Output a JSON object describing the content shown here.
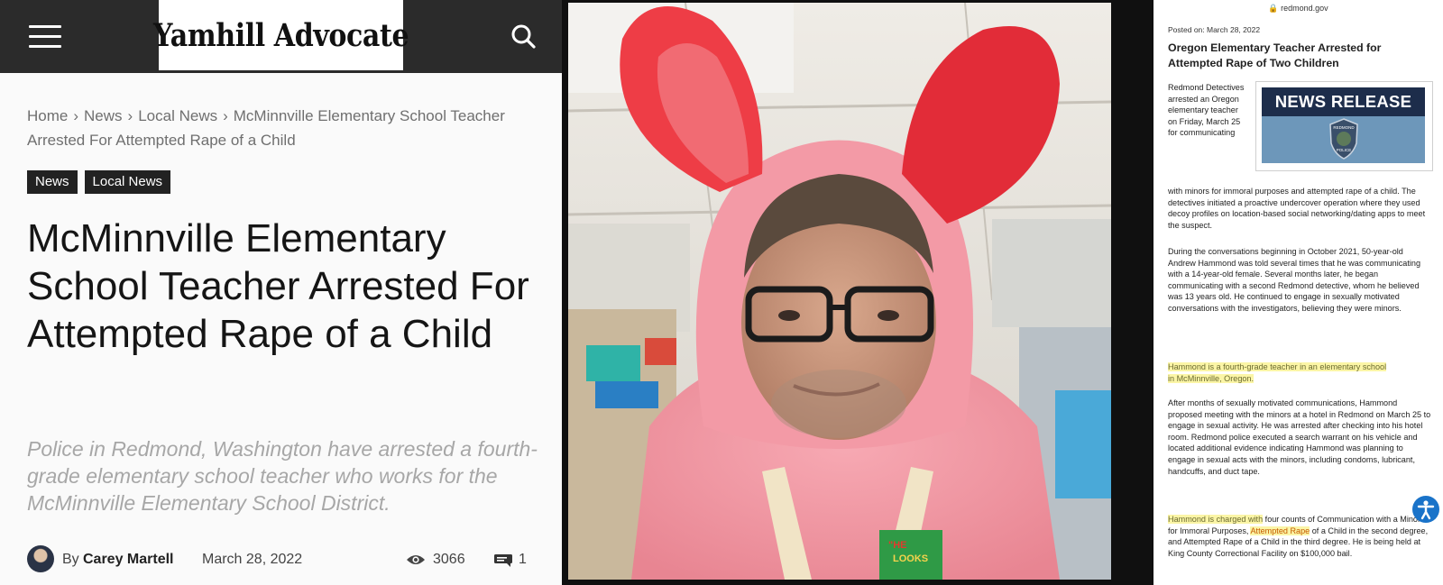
{
  "article": {
    "site_name": "Yamhill Advocate",
    "breadcrumb": [
      "Home",
      "News",
      "Local News",
      "McMinnville Elementary School Teacher Arrested For Attempted Rape of a Child"
    ],
    "breadcrumb_sep": "›",
    "tags": [
      "News",
      "Local News"
    ],
    "headline": "McMinnville Elementary School Teacher Arrested For Attempted Rape of a Child",
    "subtitle": "Police in Redmond, Washington have arrested a fourth-grade elementary school teacher who works for the McMinnville Elementary School District.",
    "byline": {
      "by": "By",
      "author": "Carey Martell",
      "date": "March 28, 2022",
      "views": "3066",
      "comments": "1"
    },
    "icons": {
      "menu": "hamburger-menu-icon",
      "search": "search-icon",
      "views": "eye-icon",
      "comments": "comment-icon"
    }
  },
  "photo": {
    "badge_text": [
      "\"HE",
      "LOOKS"
    ]
  },
  "press_release": {
    "url": "🔒 redmond.gov",
    "posted": "Posted on: March 28, 2022",
    "title": "Oregon Elementary Teacher Arrested for Attempted Rape of Two Children",
    "banner_title": "NEWS RELEASE",
    "badge_lines": [
      "REDMOND",
      "POLICE"
    ],
    "p1_narrow": "Redmond Detectives arrested an Oregon elementary teacher on Friday, March 25 for communicating",
    "p1_rest": "with minors for immoral purposes and attempted rape of a child. The detectives initiated a proactive undercover operation where they used decoy profiles on location-based social networking/dating apps to meet the suspect.",
    "p2": "During the conversations beginning in October 2021, 50-year-old Andrew Hammond was told several times that he was communicating with a 14-year-old female. Several months later, he began communicating with a second Redmond detective, whom he believed was 13 years old. He continued to engage in sexually motivated conversations with the investigators, believing they were minors.",
    "p3": "Hammond is a fourth-grade teacher in an elementary school in McMinnville, Oregon.",
    "p4": "After months of sexually motivated communications, Hammond proposed meeting with the minors at a hotel in Redmond on March 25 to engage in sexual activity. He was arrested after checking into his hotel room. Redmond police executed a search warrant on his vehicle and located additional evidence indicating Hammond was planning to engage in sexual acts with the minors, including condoms, lubricant, handcuffs, and duct tape.",
    "p5_hl": "Hammond is charged with",
    "p5_a": " four counts of Communication with a Minor for Immoral Purposes, ",
    "p5_hl2": "Attempted Rape",
    "p5_b": " of a Child in the second degree, and Attempted Rape of a Child in the third degree. He is being held at King County Correctional Facility on $100,000 bail.",
    "accessibility_icon": "accessibility-icon"
  }
}
